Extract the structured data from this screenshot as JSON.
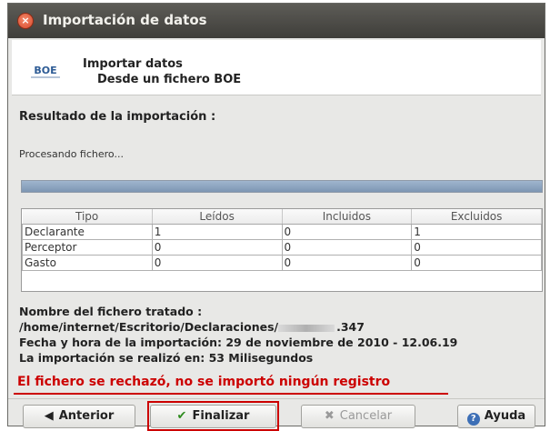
{
  "window": {
    "title": "Importación de datos"
  },
  "header": {
    "logo_text": "BOE",
    "title": "Importar datos",
    "subtitle": "Desde un fichero BOE"
  },
  "result": {
    "section_title": "Resultado de la importación :",
    "processing_text": "Procesando fichero...",
    "progress": 1.0
  },
  "table": {
    "columns": [
      "Tipo",
      "Leídos",
      "Incluidos",
      "Excluidos"
    ],
    "rows": [
      [
        "Declarante",
        "1",
        "0",
        "1"
      ],
      [
        "Perceptor",
        "0",
        "0",
        "0"
      ],
      [
        "Gasto",
        "0",
        "0",
        "0"
      ]
    ]
  },
  "summary": {
    "file_label": "Nombre del fichero tratado :",
    "file_path_prefix": "/home/internet/Escritorio/Declaraciones/",
    "file_path_suffix": ".347",
    "date_line": "Fecha y hora de la importación: 29 de noviembre de 2010 - 12.06.19",
    "duration_line": "La importación se realizó en: 53 Milisegundos",
    "error_message": "El fichero se rechazó, no se importó ningún registro"
  },
  "buttons": {
    "previous": "Anterior",
    "finish": "Finalizar",
    "cancel": "Cancelar",
    "help": "Ayuda"
  },
  "colors": {
    "error": "#cc0000",
    "progress": "#7d96b3"
  }
}
